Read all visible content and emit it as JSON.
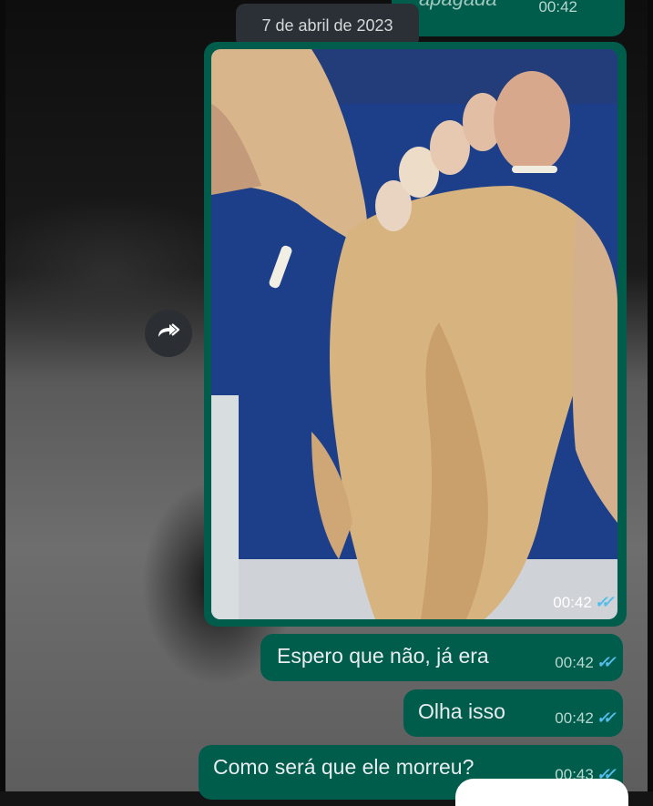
{
  "chat": {
    "date_separator": "7 de abril de 2023",
    "top_message": {
      "text": "apagada",
      "time": "00:42"
    },
    "image_message": {
      "time": "00:42",
      "status": "read"
    },
    "messages": [
      {
        "text": "Espero que não, já era",
        "time": "00:42",
        "status": "read"
      },
      {
        "text": "Olha isso",
        "time": "00:42",
        "status": "read"
      },
      {
        "text": "Como será que ele morreu?",
        "time": "00:43",
        "status": "read"
      }
    ]
  },
  "icons": {
    "forward": "forward-icon",
    "read_receipt": "double-check-icon"
  },
  "colors": {
    "outgoing_bubble": "#005c4b",
    "read_ticks": "#53bdeb",
    "date_chip": "#2a3035"
  }
}
